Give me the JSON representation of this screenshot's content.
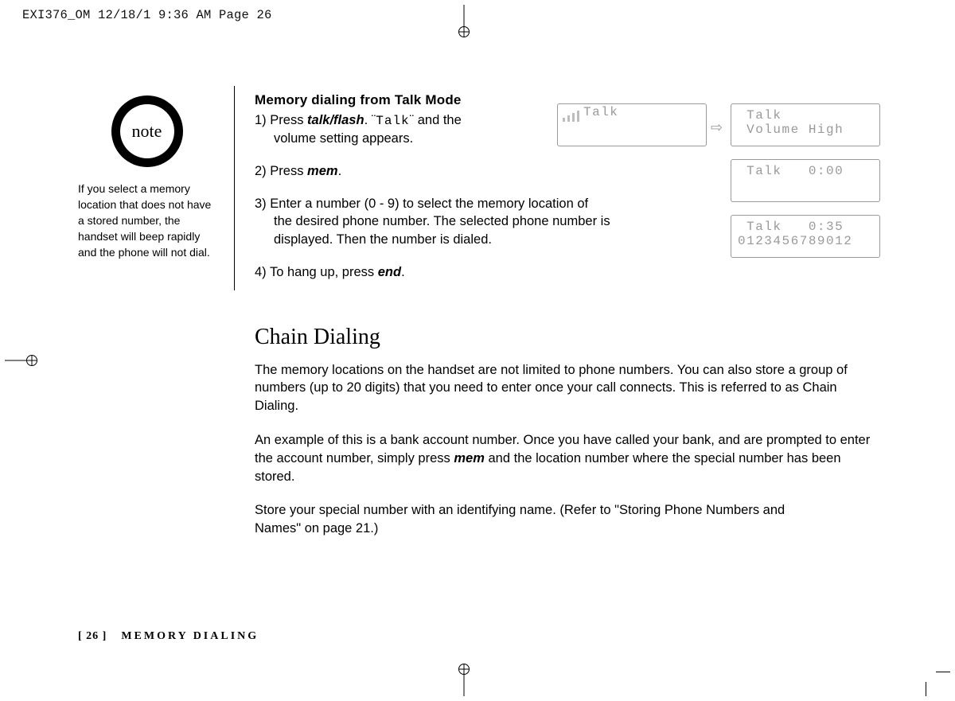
{
  "header_slug": "EXI376_OM  12/18/1 9:36 AM  Page 26",
  "note": {
    "badge": "note",
    "text": "If you select a memory location that does not have a stored number, the handset will beep rapidly and the phone will not dial."
  },
  "section": {
    "subheading": "Memory dialing from Talk Mode",
    "step1_num": "1) ",
    "step1_a": "Press ",
    "step1_kw": "talk/flash",
    "step1_b": ". ",
    "step1_q1": "¨",
    "step1_mono": "Talk",
    "step1_q2": "¨",
    "step1_c": " and the",
    "step1_line2": "volume setting appears.",
    "step2_num": "2) ",
    "step2_a": "Press ",
    "step2_kw": "mem",
    "step2_b": ".",
    "step3_num": "3) ",
    "step3_line1": "Enter a number (0 - 9) to select the memory location of",
    "step3_line2": "the desired phone number. The selected phone number is",
    "step3_line3": "displayed. Then the number is dialed.",
    "step4_num": "4) ",
    "step4_a": "To hang up, press ",
    "step4_kw": "end",
    "step4_b": "."
  },
  "chain": {
    "heading": "Chain Dialing",
    "p1": "The memory locations on the handset are not limited to phone numbers. You can also store a group of numbers (up to 20 digits) that you need to enter once your call connects. This is referred to as Chain Dialing.",
    "p2a": "An example of this is a bank account number. Once you have called your bank, and are prompted to enter the account number, simply press ",
    "p2_kw": "mem",
    "p2b": " and the location number where the special number has been stored.",
    "p3": "Store your special number with an identifying name. (Refer to \"Storing Phone Numbers and Names\" on page 21.)"
  },
  "lcd": {
    "s1": "Talk",
    "s2l1": " Talk",
    "s2l2": " Volume High",
    "s3": " Talk   0:00",
    "s4l1": " Talk   0:35",
    "s4l2": "0123456789012"
  },
  "footer": {
    "page": "[ 26 ]",
    "section": "MEMORY DIALING"
  }
}
